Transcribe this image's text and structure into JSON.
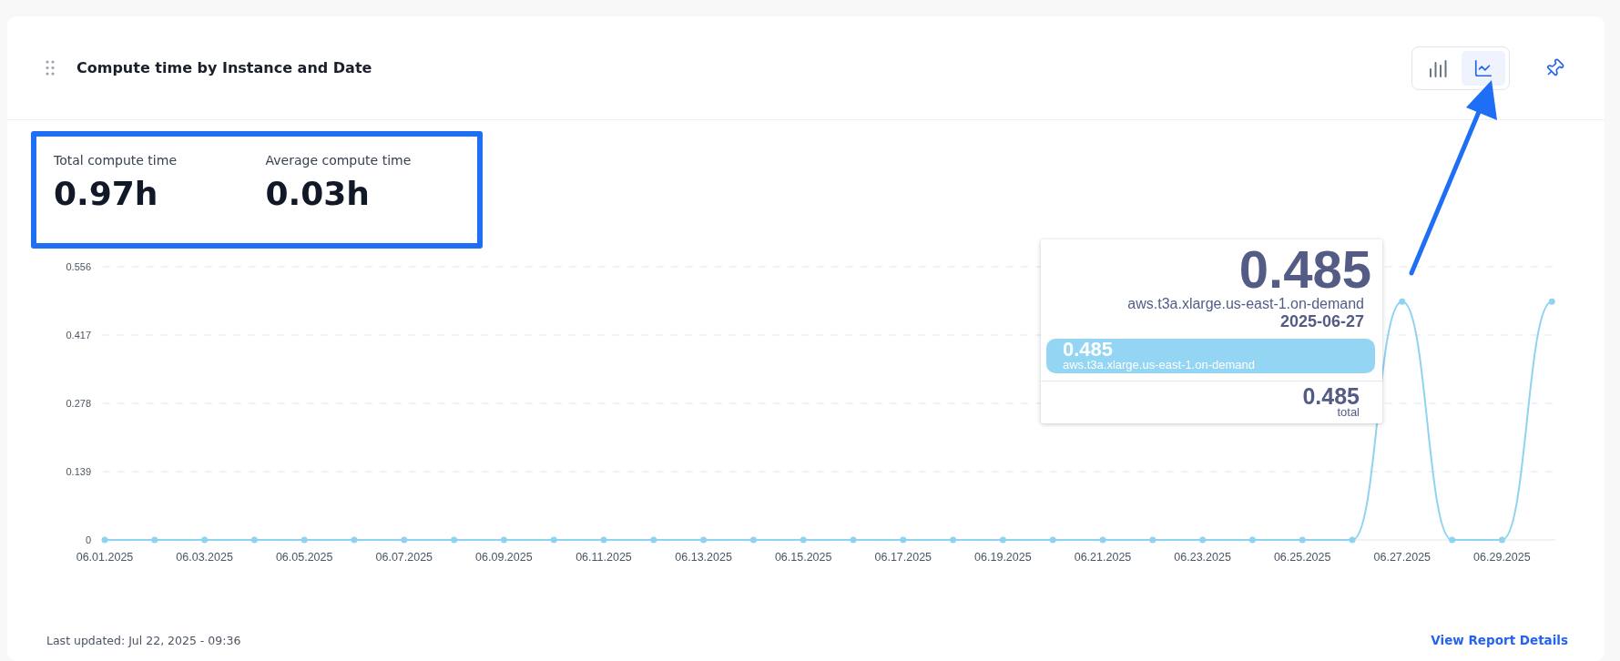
{
  "header": {
    "title": "Compute time by Instance and Date",
    "chart_types": [
      {
        "kind": "bar",
        "selected": false
      },
      {
        "kind": "line",
        "selected": true
      }
    ]
  },
  "stats": [
    {
      "label": "Total compute time",
      "value": "0.97h"
    },
    {
      "label": "Average compute time",
      "value": "0.03h"
    }
  ],
  "chart": {
    "chart_data": {
      "type": "line",
      "ylim": [
        0,
        0.556
      ],
      "yticks": [
        {
          "value": 0,
          "label": "0"
        },
        {
          "value": 0.139,
          "label": "0.139"
        },
        {
          "value": 0.278,
          "label": "0.278"
        },
        {
          "value": 0.417,
          "label": "0.417"
        },
        {
          "value": 0.556,
          "label": "0.556"
        }
      ],
      "grid": true,
      "categories": [
        "06.01.2025",
        null,
        "06.03.2025",
        null,
        "06.05.2025",
        null,
        "06.07.2025",
        null,
        "06.09.2025",
        null,
        "06.11.2025",
        null,
        "06.13.2025",
        null,
        "06.15.2025",
        null,
        "06.17.2025",
        null,
        "06.19.2025",
        null,
        "06.21.2025",
        null,
        "06.23.2025",
        null,
        "06.25.2025",
        null,
        "06.27.2025",
        null,
        "06.29.2025",
        null
      ],
      "series": [
        {
          "name": "aws.t3a.xlarge.us-east-1.on-demand",
          "color": "#8fd3f1",
          "marker": true,
          "values": [
            0,
            0,
            0,
            0,
            0,
            0,
            0,
            0,
            0,
            0,
            0,
            0,
            0,
            0,
            0,
            0,
            0,
            0,
            0,
            0,
            0,
            0,
            0,
            0,
            0,
            0,
            0.485,
            0,
            0,
            0.485
          ]
        }
      ]
    },
    "tooltip": {
      "value": "0.485",
      "date": "2025-06-27",
      "item_value": "0.485",
      "item_series": "aws.t3a.xlarge.us-east-1.on-demand",
      "total_value": "0.485",
      "total_label": "total"
    }
  },
  "footer": {
    "updated": "Last updated: Jul 22, 2025 - 09:36",
    "link": "View Report Details"
  }
}
